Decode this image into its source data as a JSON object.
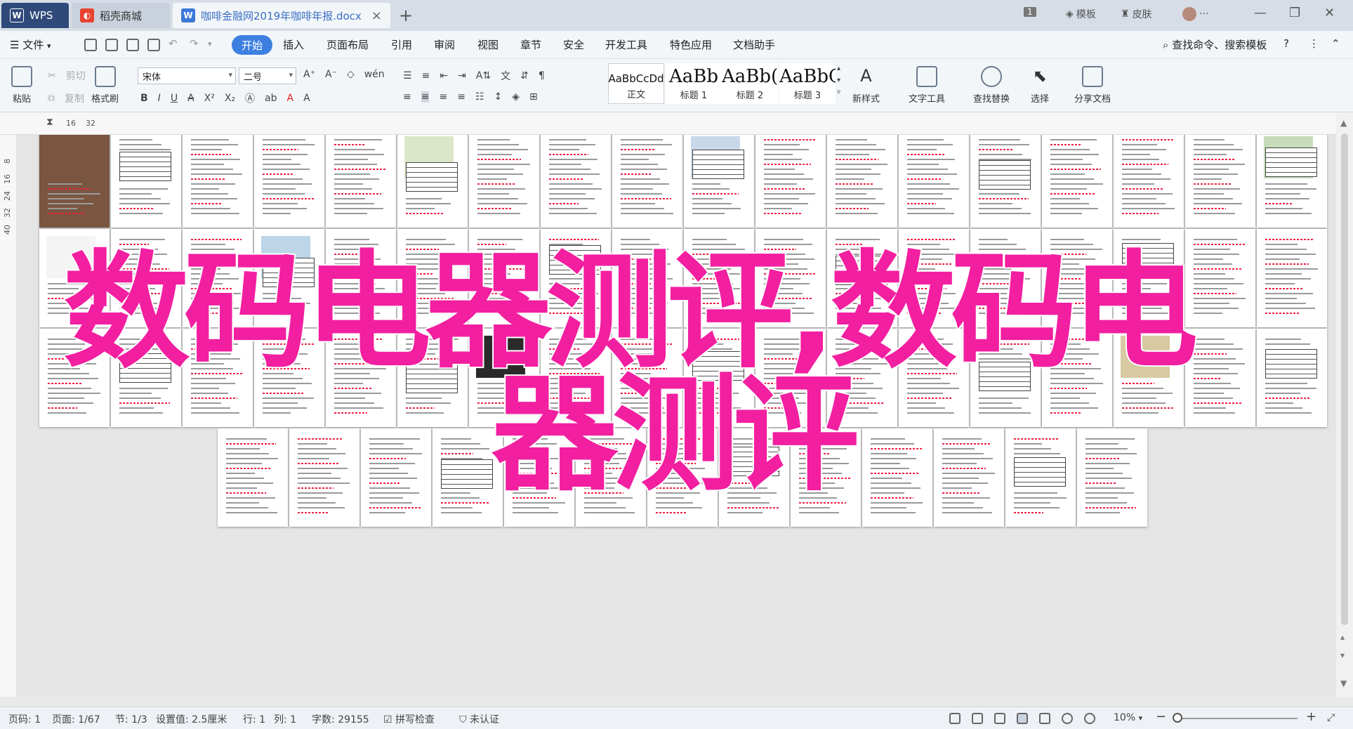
{
  "titlebar": {
    "tabs": [
      {
        "label": "WPS",
        "icon": "wps-logo-icon"
      },
      {
        "label": "稻壳商城",
        "icon": "docer-store-icon"
      },
      {
        "label": "咖啡金融网2019年咖啡年报.docx",
        "icon": "word-doc-icon"
      }
    ],
    "page_badge": "1",
    "template_label": "模板",
    "skin_label": "皮肤"
  },
  "menubar": {
    "file_label": "文件",
    "items": [
      "开始",
      "插入",
      "页面布局",
      "引用",
      "审阅",
      "视图",
      "章节",
      "安全",
      "开发工具",
      "特色应用",
      "文档助手"
    ],
    "search_placeholder": "查找命令、搜索模板"
  },
  "ribbon": {
    "paste_label": "粘贴",
    "cut_label": "剪切",
    "copy_label": "复制",
    "format_painter_label": "格式刷",
    "font_name": "宋体",
    "font_size": "二号",
    "styles": [
      {
        "sample": "AaBbCcDd",
        "label": "正文"
      },
      {
        "sample": "AaBb",
        "label": "标题 1"
      },
      {
        "sample": "AaBb(",
        "label": "标题 2"
      },
      {
        "sample": "AaBbC",
        "label": "标题 3"
      }
    ],
    "new_style_label": "新样式",
    "text_tools_label": "文字工具",
    "find_replace_label": "查找替换",
    "select_label": "选择",
    "share_label": "分享文档"
  },
  "ruler": {
    "marks": [
      "16",
      "32"
    ]
  },
  "vruler": {
    "marks": [
      "8",
      "16",
      "24",
      "32",
      "40"
    ]
  },
  "overlay": {
    "line1": "数码电器测评,数码电",
    "line2": "器测评"
  },
  "statusbar": {
    "page_num": "页码: 1",
    "page": "页面: 1/67",
    "section": "节: 1/3",
    "setting": "设置值: 2.5厘米",
    "row": "行: 1",
    "col": "列: 1",
    "word_count": "字数: 29155",
    "spell_check": "拼写检查",
    "uncertified": "未认证",
    "zoom": "10%"
  },
  "colors": {
    "accent": "#3d7fe0",
    "overlay": "#f21fa0"
  }
}
